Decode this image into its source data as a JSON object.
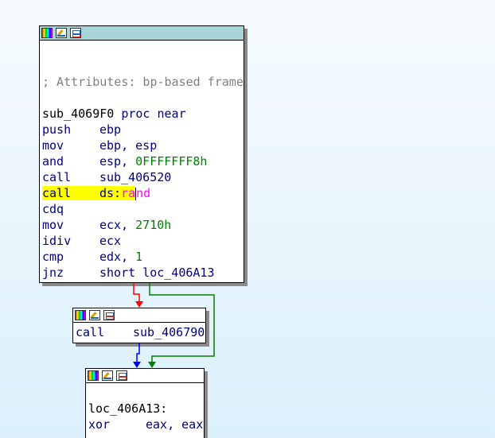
{
  "node1": {
    "comment": "; Attributes: bp-based frame",
    "proc_name": "sub_4069F0",
    "proc_kw": "proc near",
    "lines": [
      {
        "mn": "push",
        "op": "ebp"
      },
      {
        "mn": "mov",
        "op": "ebp, esp"
      },
      {
        "mn": "and",
        "op_pre": "esp, ",
        "num": "0FFFFFFF8h"
      },
      {
        "mn": "call",
        "op": "sub_406520"
      },
      {
        "mn": "call",
        "op_pre": "ds:",
        "imp_a": "ra",
        "imp_b": "nd"
      },
      {
        "mn": "cdq",
        "op": ""
      },
      {
        "mn": "mov",
        "op_pre": "ecx, ",
        "num": "2710h"
      },
      {
        "mn": "idiv",
        "op": "ecx"
      },
      {
        "mn": "cmp",
        "op_pre": "edx, ",
        "num": "1"
      },
      {
        "mn": "jnz",
        "op": "short loc_406A13"
      }
    ]
  },
  "node2": {
    "mn": "call",
    "op": "sub_406790"
  },
  "node3": {
    "label": "loc_406A13:",
    "mn": "xor",
    "op": "eax, eax"
  },
  "colors": {
    "edge_false": "#ff0000",
    "edge_true": "#008000",
    "edge_flow": "#0000ff",
    "header_active": "#a7d5d8",
    "highlight": "#ffff00"
  },
  "icons": [
    "color-palette-icon",
    "edit-icon",
    "graph-icon"
  ]
}
